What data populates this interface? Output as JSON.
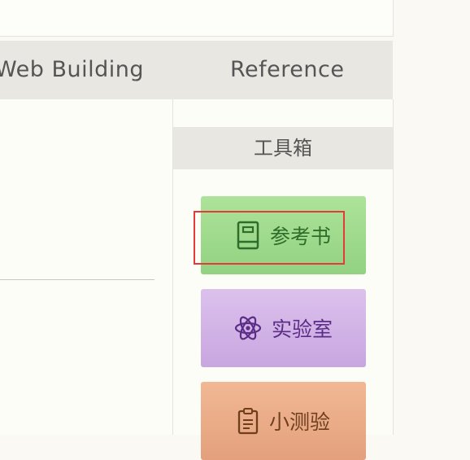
{
  "nav": {
    "tabs": [
      {
        "label": "Web Building"
      },
      {
        "label": "Reference"
      }
    ]
  },
  "toolbox": {
    "title": "工具箱",
    "buttons": [
      {
        "label": "参考书",
        "icon": "book-icon",
        "color": "#9bd88a"
      },
      {
        "label": "实验室",
        "icon": "atom-icon",
        "color": "#d2b2e6"
      },
      {
        "label": "小测验",
        "icon": "clipboard-icon",
        "color": "#eba984"
      }
    ]
  },
  "highlight": {
    "color": "#e43a3a"
  }
}
